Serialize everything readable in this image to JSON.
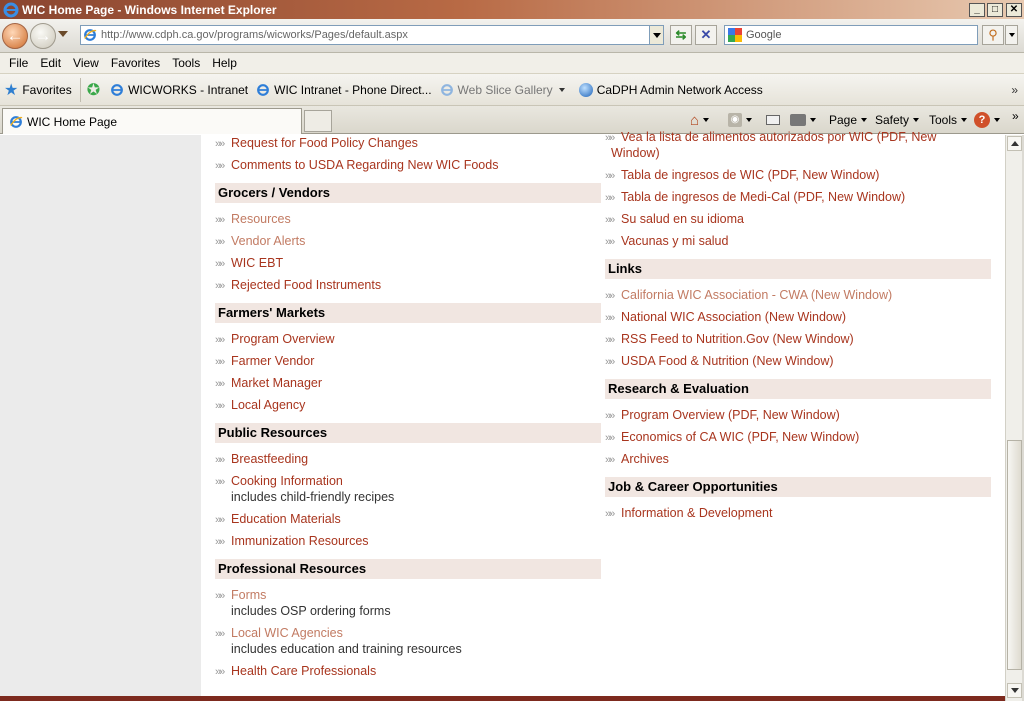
{
  "window": {
    "title": "WIC Home Page - Windows Internet Explorer",
    "min": "_",
    "max": "□",
    "close": "✕"
  },
  "address": {
    "url": "http://www.cdph.ca.gov/programs/wicworks/Pages/default.aspx",
    "search_placeholder": "Google"
  },
  "menu": [
    "File",
    "Edit",
    "View",
    "Favorites",
    "Tools",
    "Help"
  ],
  "favorites": {
    "label": "Favorites",
    "items": [
      "WICWORKS - Intranet",
      "WIC Intranet - Phone Direct...",
      "Web Slice Gallery",
      "CaDPH Admin Network Access"
    ]
  },
  "tab": {
    "title": "WIC Home Page"
  },
  "commands": {
    "page": "Page",
    "safety": "Safety",
    "tools": "Tools"
  },
  "left_column": {
    "top_links": [
      "Request for Food Policy Changes",
      "Comments to USDA Regarding New WIC Foods"
    ],
    "grocers": {
      "heading": "Grocers / Vendors",
      "links": [
        "Resources",
        "Vendor Alerts",
        "WIC EBT",
        "Rejected Food Instruments"
      ]
    },
    "farmers": {
      "heading": "Farmers' Markets",
      "links": [
        "Program Overview",
        "Farmer Vendor",
        "Market Manager",
        "Local Agency"
      ]
    },
    "public": {
      "heading": "Public Resources",
      "links": [
        "Breastfeeding",
        "Cooking Information",
        "Education Materials",
        "Immunization Resources"
      ],
      "cooking_sub": "includes child-friendly recipes"
    },
    "professional": {
      "heading": "Professional Resources",
      "links": [
        "Forms",
        "Local WIC Agencies",
        "Health Care Professionals"
      ],
      "forms_sub": "includes OSP ordering forms",
      "agencies_sub": "includes education and training resources"
    }
  },
  "right_column": {
    "top_link_line1": "Vea la lista de alimentos autorizados por WIC (PDF, New",
    "top_link_line2": "Window)",
    "top_links": [
      "Tabla de ingresos de WIC (PDF, New Window)",
      "Tabla de ingresos de Medi-Cal (PDF, New Window)",
      "Su salud en su idioma",
      "Vacunas y mi salud"
    ],
    "links": {
      "heading": "Links",
      "items": [
        "California WIC Association - CWA (New Window)",
        "National WIC Association (New Window)",
        "RSS Feed to Nutrition.Gov (New Window)",
        "USDA Food & Nutrition (New Window)"
      ]
    },
    "research": {
      "heading": "Research & Evaluation",
      "items": [
        "Program Overview (PDF, New Window)",
        "Economics of CA WIC (PDF, New Window)",
        "Archives"
      ]
    },
    "jobs": {
      "heading": "Job & Career Opportunities",
      "items": [
        "Information & Development"
      ]
    }
  },
  "colors": {
    "link": "#a8351e",
    "visited_link": "#c27b63",
    "section_bg": "#f1e6e1",
    "footer_bar": "#7d2a1e"
  }
}
